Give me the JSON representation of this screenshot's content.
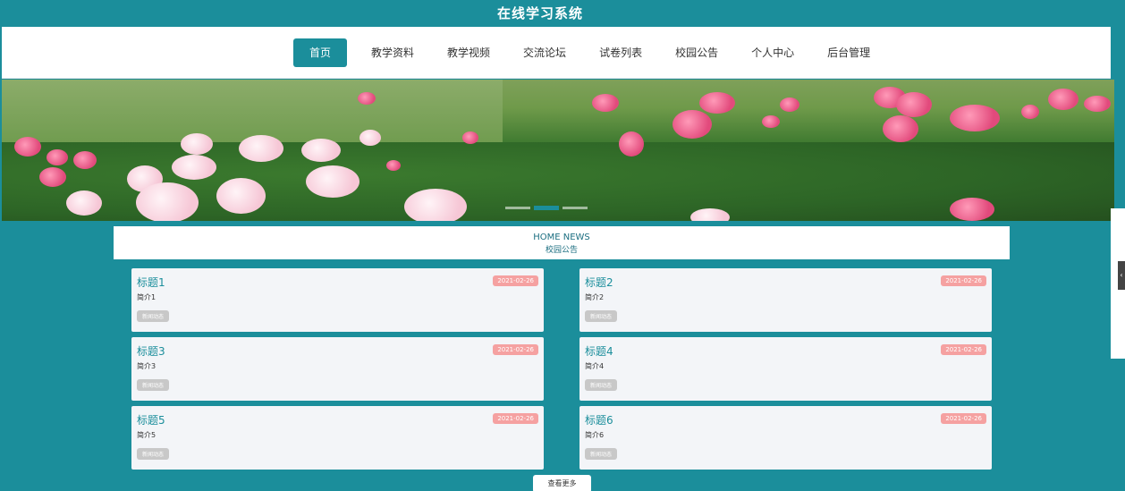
{
  "header": {
    "title": "在线学习系统"
  },
  "nav": {
    "items": [
      {
        "label": "首页",
        "active": true
      },
      {
        "label": "教学资料",
        "active": false
      },
      {
        "label": "教学视频",
        "active": false
      },
      {
        "label": "交流论坛",
        "active": false
      },
      {
        "label": "试卷列表",
        "active": false
      },
      {
        "label": "校园公告",
        "active": false
      },
      {
        "label": "个人中心",
        "active": false
      },
      {
        "label": "后台管理",
        "active": false
      }
    ]
  },
  "banner": {
    "slides": 3,
    "active_index": 1
  },
  "news_section": {
    "title_en": "HOME NEWS",
    "title_cn": "校园公告",
    "items": [
      {
        "title": "标题1",
        "brief": "简介1",
        "date": "2021-02-26",
        "tag": "新闻动态"
      },
      {
        "title": "标题2",
        "brief": "简介2",
        "date": "2021-02-26",
        "tag": "新闻动态"
      },
      {
        "title": "标题3",
        "brief": "简介3",
        "date": "2021-02-26",
        "tag": "新闻动态"
      },
      {
        "title": "标题4",
        "brief": "简介4",
        "date": "2021-02-26",
        "tag": "新闻动态"
      },
      {
        "title": "标题5",
        "brief": "简介5",
        "date": "2021-02-26",
        "tag": "新闻动态"
      },
      {
        "title": "标题6",
        "brief": "简介6",
        "date": "2021-02-26",
        "tag": "新闻动态"
      }
    ],
    "more_label": "查看更多"
  },
  "colors": {
    "primary": "#1b8e9b",
    "date_badge": "#f5a1a1",
    "tag_badge": "#c8c8c8",
    "card_bg": "#f3f5f8"
  },
  "icons": {
    "side_handle": "chevron-left-icon"
  }
}
